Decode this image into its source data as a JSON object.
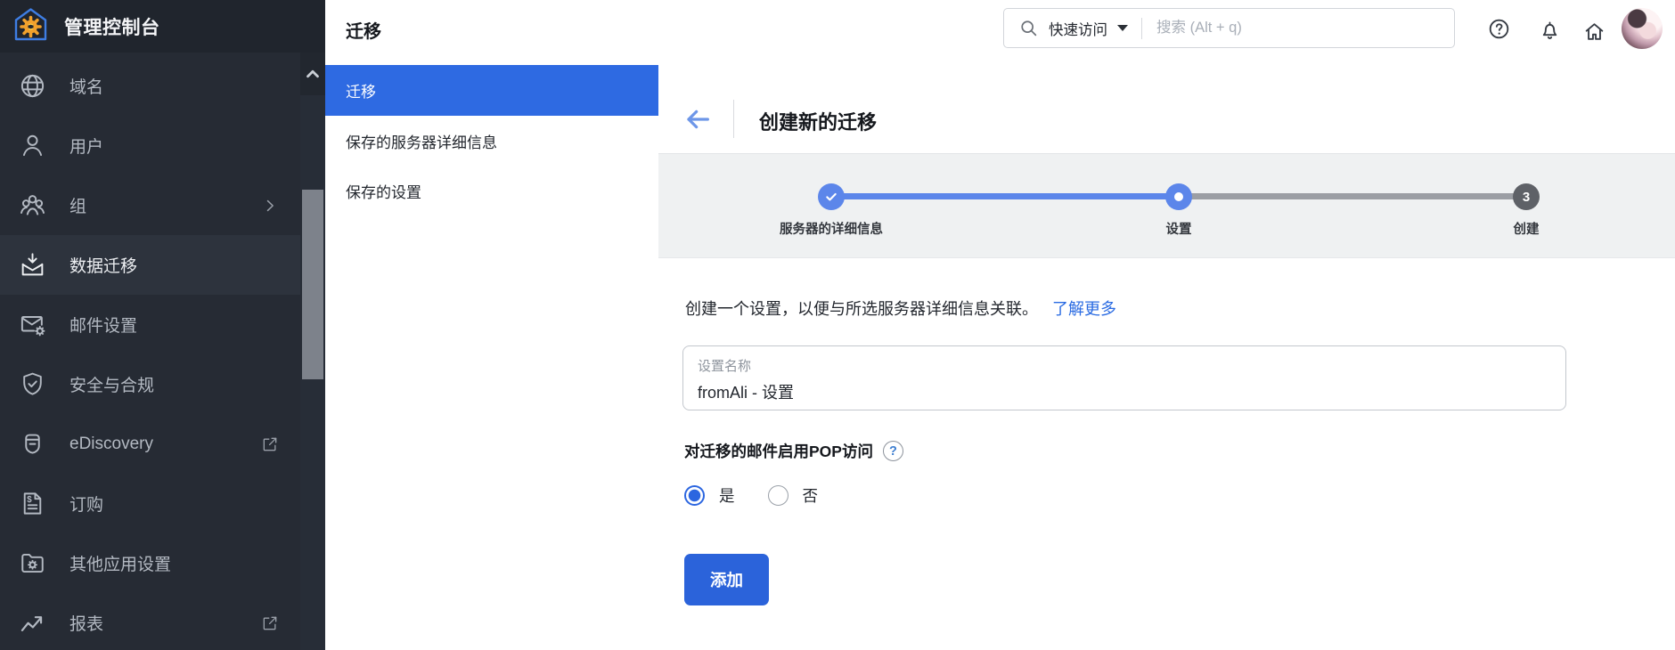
{
  "app": {
    "title": "管理控制台",
    "logo_icon": "admin-home-gear-icon"
  },
  "sidebar": {
    "items": [
      {
        "label": "域名",
        "icon": "globe"
      },
      {
        "label": "用户",
        "icon": "user"
      },
      {
        "label": "组",
        "icon": "group",
        "chevron": true
      },
      {
        "label": "数据迁移",
        "icon": "migration",
        "selected": true
      },
      {
        "label": "邮件设置",
        "icon": "mail-gear"
      },
      {
        "label": "安全与合规",
        "icon": "shield-check"
      },
      {
        "label": "eDiscovery",
        "icon": "archive",
        "external": true
      },
      {
        "label": "订购",
        "icon": "billing"
      },
      {
        "label": "其他应用设置",
        "icon": "folder-gear"
      },
      {
        "label": "报表",
        "icon": "reports",
        "external": true
      }
    ]
  },
  "subsidebar": {
    "title": "迁移",
    "items": [
      {
        "label": "迁移",
        "selected": true
      },
      {
        "label": "保存的服务器详细信息"
      },
      {
        "label": "保存的设置"
      }
    ]
  },
  "header": {
    "quick_access_label": "快速访问",
    "search_placeholder": "搜索 (Alt + q)",
    "icons": [
      "search-icon",
      "help-icon",
      "notifications-icon",
      "home-icon",
      "user-avatar"
    ]
  },
  "main": {
    "page_title": "创建新的迁移",
    "stepper": [
      {
        "label": "服务器的详细信息",
        "state": "done"
      },
      {
        "label": "设置",
        "state": "current"
      },
      {
        "label": "创建",
        "state": "todo",
        "number": "3"
      }
    ],
    "description": "创建一个设置，以便与所选服务器详细信息关联。",
    "learn_more_label": "了解更多",
    "setting_name": {
      "label": "设置名称",
      "value": "fromAli - 设置"
    },
    "pop_section": {
      "label": "对迁移的邮件启用POP访问",
      "help_glyph": "?"
    },
    "radio_group": {
      "options": [
        "是",
        "否"
      ],
      "selected_index": 0
    },
    "add_button_label": "添加"
  },
  "colors": {
    "accent_blue": "#2e6ae2",
    "stepper_blue": "#5c86ea",
    "stepper_gray": "#9b9ea4",
    "sidebar_dark": "#262b34",
    "band_gray": "#eff1f2",
    "link_blue": "#2a6be2"
  }
}
